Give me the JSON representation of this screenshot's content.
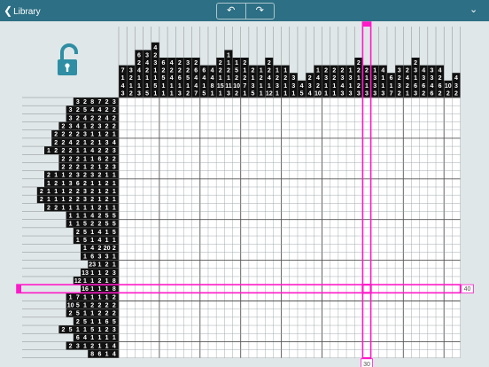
{
  "nav": {
    "back_label": "Library",
    "undo_icon": "undo-icon",
    "redo_icon": "redo-icon",
    "menu_icon": "chevron-down-icon"
  },
  "lock": {
    "icon": "unlocked-padlock-icon",
    "color": "#2f8ea3"
  },
  "colors": {
    "highlight": "#ff19c8",
    "clue_bg": "#111111",
    "grid_line": "#9aa3a8"
  },
  "highlight": {
    "row_label": "40",
    "col_label": "30",
    "row": 40,
    "col": 30
  },
  "col_clues": [
    [
      "7",
      "1",
      "4",
      "3"
    ],
    [
      "3",
      "2",
      "1",
      "2"
    ],
    [
      "6",
      "2",
      "4",
      "1",
      "1",
      "3"
    ],
    [
      "3",
      "4",
      "2",
      "1",
      "1",
      "5"
    ],
    [
      "4",
      "2",
      "3",
      "1",
      "1",
      "5",
      "1"
    ],
    [
      "6",
      "2",
      "5",
      "1",
      "1"
    ],
    [
      "4",
      "2",
      "4",
      "1",
      "1"
    ],
    [
      "2",
      "2",
      "6",
      "1",
      "3"
    ],
    [
      "3",
      "2",
      "5",
      "1",
      "2"
    ],
    [
      "2",
      "6",
      "4",
      "4",
      "7"
    ],
    [
      "6",
      "4",
      "1",
      "5"
    ],
    [
      "4",
      "4",
      "8",
      "1"
    ],
    [
      "2",
      "2",
      "1",
      "15",
      "1"
    ],
    [
      "1",
      "1",
      "2",
      "1",
      "11",
      "3"
    ],
    [
      "1",
      "5",
      "2",
      "10",
      "2"
    ],
    [
      "2",
      "1",
      "2",
      "7",
      "1"
    ],
    [
      "2",
      "1",
      "3",
      "5"
    ],
    [
      "1",
      "2",
      "1",
      "1"
    ],
    [
      "2",
      "2",
      "4",
      "1",
      "12"
    ],
    [
      "1",
      "2",
      "3",
      "1"
    ],
    [
      "1",
      "2",
      "1",
      "1"
    ],
    [
      "3",
      "3",
      "1"
    ],
    [
      "4",
      "5"
    ],
    [
      "2",
      "3",
      "4"
    ],
    [
      "1",
      "4",
      "2",
      "10"
    ],
    [
      "2",
      "3",
      "1",
      "1"
    ],
    [
      "2",
      "2",
      "1",
      "1"
    ],
    [
      "2",
      "3",
      "4",
      "3"
    ],
    [
      "1",
      "3",
      "1",
      "3"
    ],
    [
      "2",
      "2",
      "1",
      "2",
      "3"
    ],
    [
      "2",
      "1",
      "1",
      "3"
    ],
    [
      "1",
      "3",
      "3",
      "3"
    ],
    [
      "4",
      "1",
      "1",
      "3"
    ],
    [
      "6",
      "1",
      "7"
    ],
    [
      "3",
      "2",
      "3",
      "2"
    ],
    [
      "2",
      "4",
      "2",
      "1"
    ],
    [
      "2",
      "3",
      "1",
      "6",
      "3"
    ],
    [
      "4",
      "3",
      "6",
      "2"
    ],
    [
      "3",
      "3",
      "4",
      "6"
    ],
    [
      "4",
      "2",
      "6",
      "2"
    ],
    [
      "10",
      "2"
    ],
    [
      "4",
      "3",
      "2"
    ]
  ],
  "row_clues": [
    [
      "3",
      "2",
      "8",
      "7",
      "2",
      "3"
    ],
    [
      "3",
      "2",
      "5",
      "4",
      "4",
      "2",
      "2"
    ],
    [
      "3",
      "2",
      "4",
      "2",
      "2",
      "4",
      "2"
    ],
    [
      "2",
      "3",
      "4",
      "1",
      "2",
      "3",
      "2",
      "2"
    ],
    [
      "2",
      "2",
      "2",
      "2",
      "3",
      "1",
      "1",
      "2",
      "1"
    ],
    [
      "2",
      "2",
      "4",
      "2",
      "1",
      "2",
      "1",
      "3",
      "4"
    ],
    [
      "1",
      "2",
      "2",
      "2",
      "1",
      "1",
      "4",
      "2",
      "2",
      "3"
    ],
    [
      "2",
      "2",
      "2",
      "1",
      "1",
      "6",
      "2",
      "2"
    ],
    [
      "2",
      "2",
      "2",
      "1",
      "2",
      "1",
      "2",
      "3"
    ],
    [
      "2",
      "1",
      "1",
      "2",
      "3",
      "2",
      "3",
      "2",
      "1",
      "1"
    ],
    [
      "1",
      "2",
      "1",
      "3",
      "6",
      "2",
      "1",
      "1",
      "2",
      "1"
    ],
    [
      "2",
      "1",
      "1",
      "1",
      "2",
      "2",
      "3",
      "2",
      "1",
      "2",
      "1"
    ],
    [
      "2",
      "1",
      "1",
      "1",
      "2",
      "2",
      "3",
      "2",
      "1",
      "2",
      "1"
    ],
    [
      "2",
      "2",
      "1",
      "1",
      "1",
      "1",
      "1",
      "2",
      "1",
      "1"
    ],
    [
      "1",
      "1",
      "1",
      "4",
      "2",
      "5",
      "5"
    ],
    [
      "1",
      "1",
      "5",
      "2",
      "2",
      "5",
      "5"
    ],
    [
      "2",
      "5",
      "1",
      "4",
      "1",
      "5"
    ],
    [
      "1",
      "5",
      "1",
      "4",
      "1",
      "1"
    ],
    [
      "1",
      "4",
      "2",
      "20",
      "2"
    ],
    [
      "1",
      "6",
      "3",
      "3",
      "1"
    ],
    [
      "23",
      "1",
      "2",
      "1"
    ],
    [
      "13",
      "1",
      "1",
      "2",
      "3"
    ],
    [
      "12",
      "1",
      "1",
      "2",
      "1",
      "8"
    ],
    [
      "16",
      "1",
      "1",
      "1",
      "8"
    ],
    [
      "1",
      "7",
      "1",
      "1",
      "1",
      "1",
      "2"
    ],
    [
      "10",
      "5",
      "1",
      "2",
      "2",
      "2",
      "2"
    ],
    [
      "2",
      "5",
      "1",
      "1",
      "2",
      "2",
      "2"
    ],
    [
      "2",
      "5",
      "1",
      "1",
      "6",
      "5"
    ],
    [
      "2",
      "5",
      "1",
      "1",
      "5",
      "1",
      "2",
      "3"
    ],
    [
      "6",
      "4",
      "1",
      "1",
      "1",
      "1"
    ],
    [
      "2",
      "3",
      "1",
      "2",
      "1",
      "1",
      "4"
    ],
    [
      "8",
      "6",
      "1",
      "4"
    ]
  ]
}
